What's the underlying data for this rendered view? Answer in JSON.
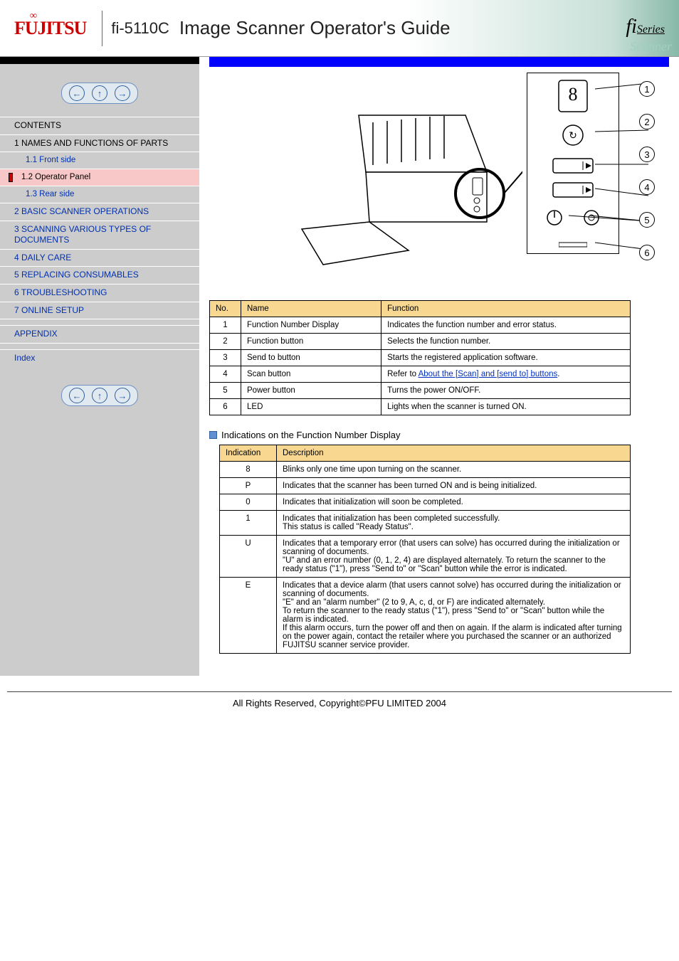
{
  "header": {
    "logo": "FUJITSU",
    "model": "fi-5110C",
    "title": "Image Scanner Operator's Guide",
    "fiseries_prefix": "fi",
    "fiseries_suffix": "Series",
    "scanner_word": "Scanner"
  },
  "sidebar": {
    "nav_prev": "←",
    "nav_up": "↑",
    "nav_next": "→",
    "items": [
      {
        "label": "CONTENTS",
        "class": "black"
      },
      {
        "label": "1 NAMES AND FUNCTIONS OF PARTS",
        "class": "black"
      },
      {
        "label": "1.1 Front side",
        "class": "level2"
      },
      {
        "label": "1.2 Operator Panel",
        "class": "level2 active"
      },
      {
        "label": "1.3 Rear side",
        "class": "level2"
      },
      {
        "label": "2 BASIC SCANNER OPERATIONS",
        "class": ""
      },
      {
        "label": "3 SCANNING VARIOUS TYPES OF DOCUMENTS",
        "class": ""
      },
      {
        "label": "4 DAILY CARE",
        "class": ""
      },
      {
        "label": "5 REPLACING CONSUMABLES",
        "class": ""
      },
      {
        "label": "6 TROUBLESHOOTING",
        "class": ""
      },
      {
        "label": "7 ONLINE SETUP",
        "class": ""
      },
      {
        "label": " ",
        "class": "black"
      },
      {
        "label": "APPENDIX",
        "class": ""
      },
      {
        "label": " ",
        "class": "black"
      },
      {
        "label": "Index",
        "class": ""
      }
    ]
  },
  "main": {
    "callouts": [
      "1",
      "2",
      "3",
      "4",
      "5",
      "6"
    ],
    "parts": {
      "headers": [
        "No.",
        "Name",
        "Function"
      ],
      "rows": [
        [
          "1",
          "Function Number Display",
          "Indicates the function number and error status."
        ],
        [
          "2",
          "Function button",
          "Selects the function number."
        ],
        [
          "3",
          "Send to button",
          "Starts the registered application software."
        ],
        [
          "4",
          "Scan button",
          "Refer to ",
          {
            "link": "About the [Scan] and [send to] buttons"
          },
          "."
        ],
        [
          "5",
          "Power button",
          "Turns the power ON/OFF."
        ],
        [
          "6",
          "LED",
          "Lights when the scanner is turned ON."
        ]
      ]
    },
    "fn_heading": "Indications on the Function Number Display",
    "fn": {
      "headers": [
        "Indication",
        "Description"
      ],
      "rows": [
        [
          "8",
          "Blinks only one time upon turning on the scanner."
        ],
        [
          "P",
          "Indicates that the scanner has been turned ON and is being initialized."
        ],
        [
          "0",
          "Indicates that initialization will soon be completed."
        ],
        [
          "1",
          "Indicates that initialization has been completed successfully.\nThis status is called \"Ready Status\"."
        ],
        [
          "U",
          "Indicates that a temporary error (that users can solve) has occurred during the initialization or scanning of documents.\n\"U\" and an error number (0, 1, 2, 4) are displayed alternately. To return the scanner to the ready status (\"1\"), press \"Send to\" or \"Scan\" button while the error is indicated."
        ],
        [
          "E",
          "Indicates that a device alarm (that users cannot solve) has occurred during the initialization or scanning of documents.\n\"E\" and an \"alarm number\" (2 to 9, A, c, d, or F) are indicated alternately.\nTo return the scanner to the ready status (\"1\"), press \"Send to\" or \"Scan\" button while the alarm is indicated.\nIf this alarm occurs, turn the power off and then on again. If the alarm is indicated after turning on the power again, contact the retailer where you purchased the scanner or an authorized FUJITSU scanner service provider."
        ]
      ]
    }
  },
  "footer": "All Rights Reserved, Copyright©PFU LIMITED 2004"
}
